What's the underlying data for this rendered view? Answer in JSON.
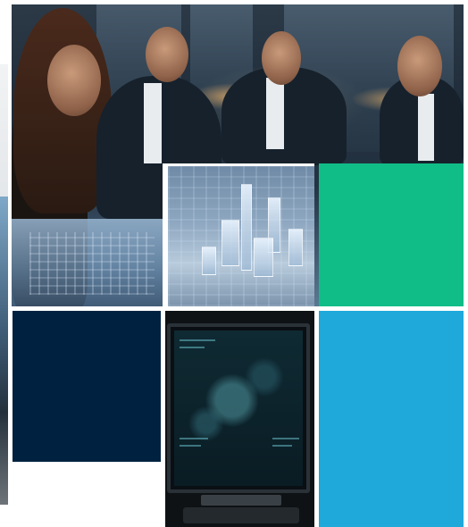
{
  "photos": {
    "hero": "team-reviewing-holographic-city-model",
    "city_model": "holographic-city-model-closeup",
    "monitor": "data-visualization-monitor"
  },
  "tiles": {
    "green": "#10bd87",
    "navy": "#002240",
    "blue": "#1ea9da"
  }
}
